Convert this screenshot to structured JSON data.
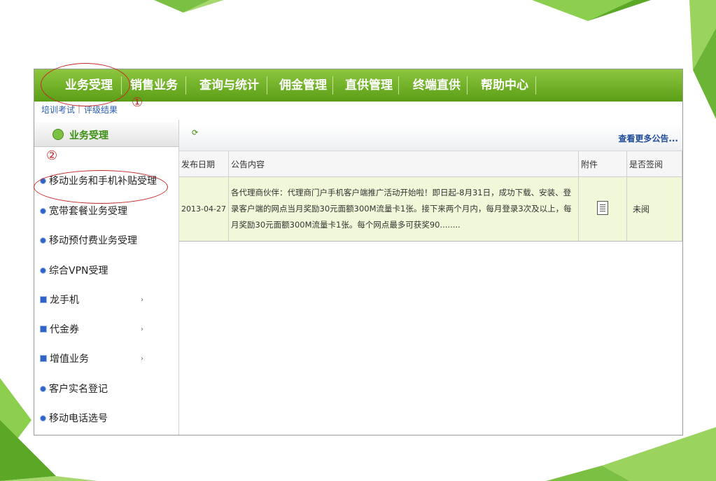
{
  "nav": {
    "items": [
      "业务受理",
      "销售业务",
      "查询与统计",
      "佣金管理",
      "直供管理",
      "终端直供",
      "帮助中心"
    ]
  },
  "subnav": {
    "training": "培训考试",
    "separator": "|",
    "ratings": "评级结果"
  },
  "annotations": {
    "mark1": "①",
    "mark2": "②"
  },
  "left_panel": {
    "title": "业务受理",
    "items": [
      {
        "label": "移动业务和手机补贴受理",
        "icon": "dot-bullet-icon",
        "submenu": false
      },
      {
        "label": "宽带套餐业务受理",
        "icon": "dot-bullet-icon",
        "submenu": false
      },
      {
        "label": "移动预付费业务受理",
        "icon": "dot-bullet-icon",
        "submenu": false
      },
      {
        "label": "综合VPN受理",
        "icon": "dot-bullet-icon",
        "submenu": false
      },
      {
        "label": "龙手机",
        "icon": "square-bullet-icon",
        "submenu": true
      },
      {
        "label": "代金券",
        "icon": "square-bullet-icon",
        "submenu": true
      },
      {
        "label": "增值业务",
        "icon": "square-bullet-icon",
        "submenu": true
      },
      {
        "label": "客户实名登记",
        "icon": "dot-bullet-icon",
        "submenu": false
      },
      {
        "label": "移动电话选号",
        "icon": "dot-bullet-icon",
        "submenu": false
      }
    ],
    "submenu_arrow": "›"
  },
  "notice": {
    "refresh_icon": "refresh-icon",
    "more_link": "查看更多公告...",
    "columns": [
      "发布日期",
      "公告内容",
      "附件",
      "是否签阅"
    ],
    "rows": [
      {
        "date": "2013-04-27",
        "content": "各代理商伙伴：代理商门户手机客户端推广活动开始啦！即日起-8月31日，成功下载、安装、登录客户端的网点当月奖励30元面额300M流量卡1张。接下来两个月内，每月登录3次及以上，每月奖励30元面额300M流量卡1张。每个网点最多可获奖90........",
        "attachment_icon": "document-icon",
        "read_status": "未阅"
      }
    ]
  },
  "colors": {
    "nav_green": "#6aab24",
    "accent_red": "#c62828",
    "link_blue": "#1f4d9a"
  }
}
